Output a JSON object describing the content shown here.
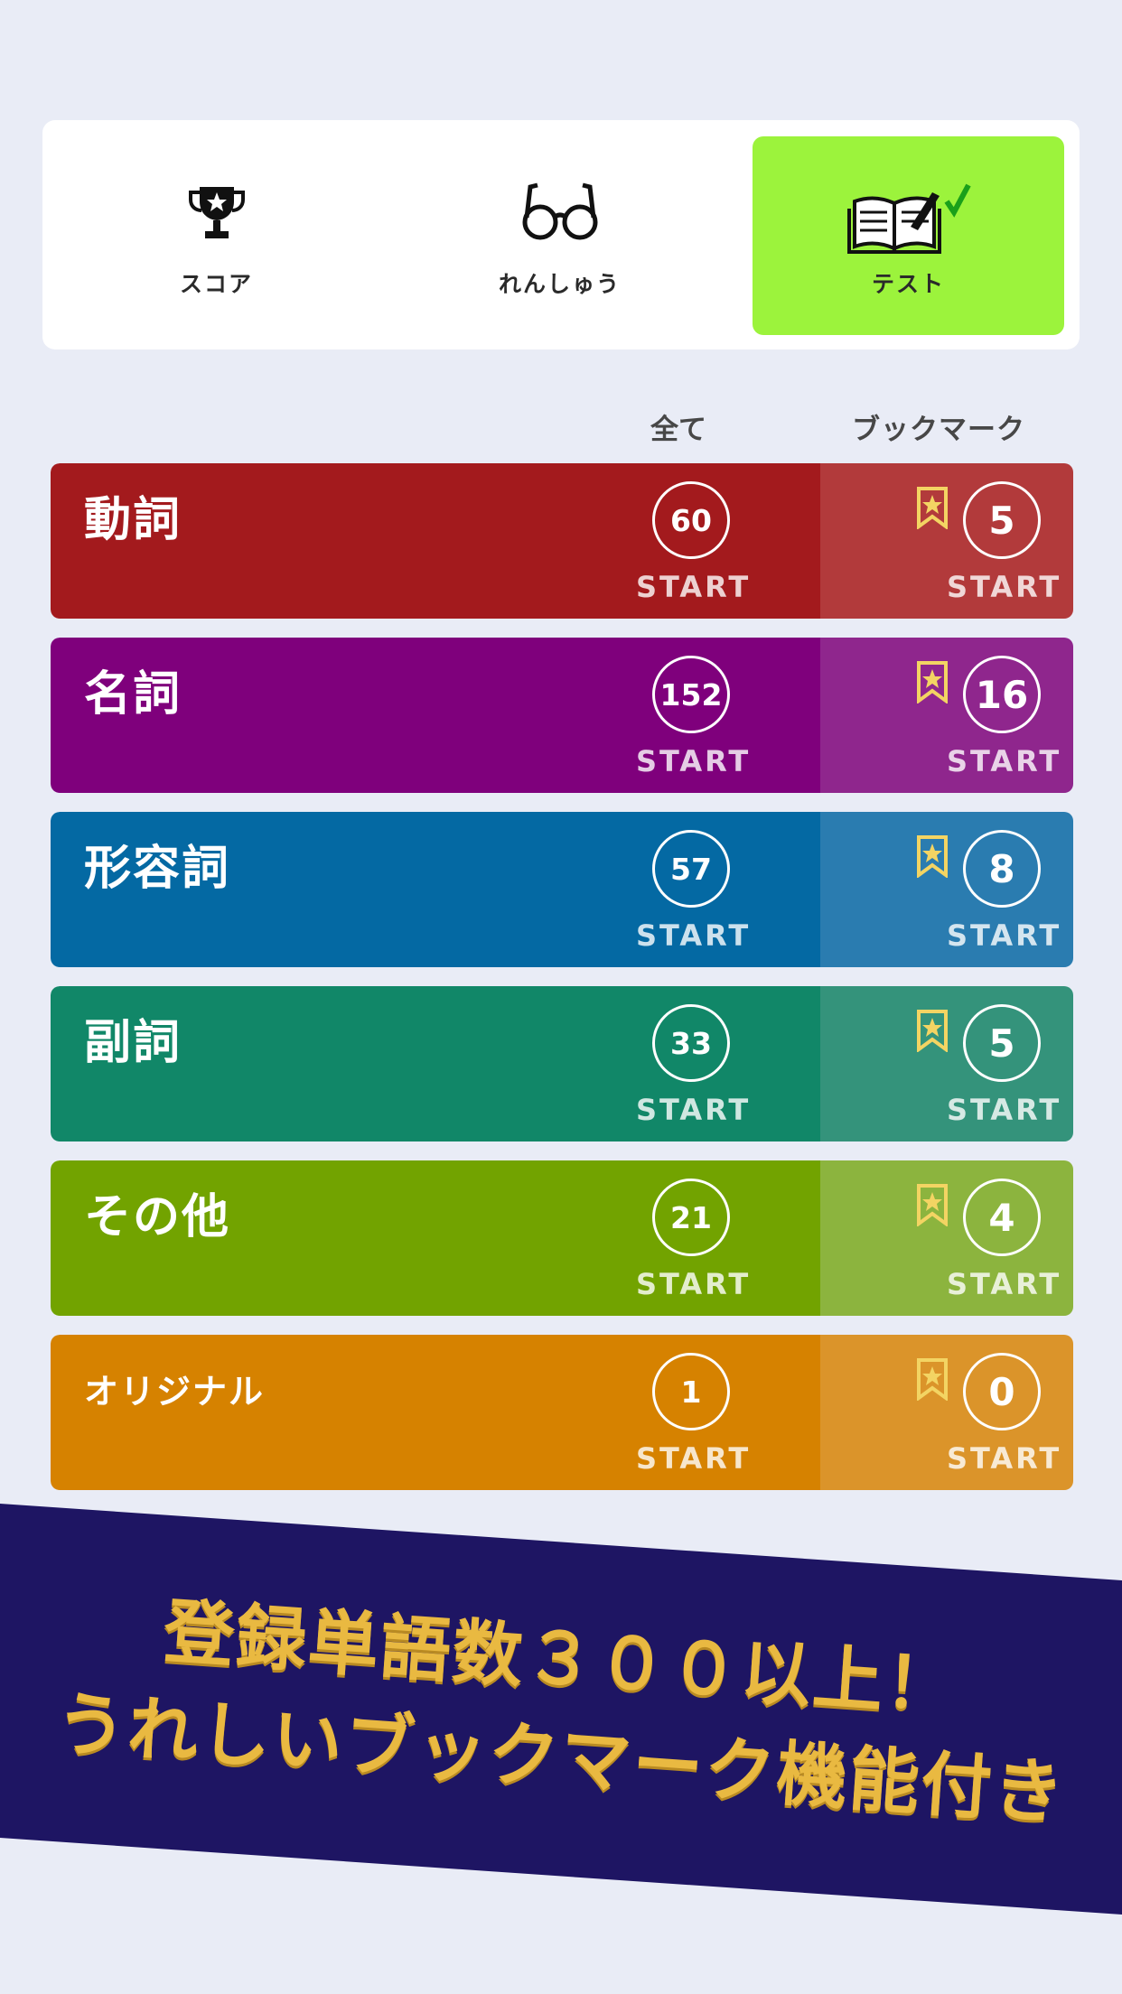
{
  "tabs": [
    {
      "label": "スコア",
      "icon": "trophy-icon"
    },
    {
      "label": "れんしゅう",
      "icon": "glasses-icon"
    },
    {
      "label": "テスト",
      "icon": "open-book-check-icon",
      "active": true
    }
  ],
  "columns": {
    "all": "全て",
    "bookmark": "ブックマーク"
  },
  "categories": [
    {
      "title": "動詞",
      "count": "60",
      "bookmark_count": "5",
      "start": "START",
      "color_main": "#a31a1d",
      "color_side": "#b23a3b"
    },
    {
      "title": "名詞",
      "count": "152",
      "bookmark_count": "16",
      "start": "START",
      "color_main": "#7f007c",
      "color_side": "#8f268d"
    },
    {
      "title": "形容詞",
      "count": "57",
      "bookmark_count": "8",
      "start": "START",
      "color_main": "#0469a3",
      "color_side": "#2a7cb0"
    },
    {
      "title": "副詞",
      "count": "33",
      "bookmark_count": "5",
      "start": "START",
      "color_main": "#118768",
      "color_side": "#34937b"
    },
    {
      "title": "その他",
      "count": "21",
      "bookmark_count": "4",
      "start": "START",
      "color_main": "#72a300",
      "color_side": "#8cb43e"
    },
    {
      "title": "オリジナル",
      "count": "1",
      "bookmark_count": "0",
      "start": "START",
      "color_main": "#d68200",
      "color_side": "#db942a"
    }
  ],
  "banner": {
    "line1": "登録単語数３００以上！",
    "line2": "うれしいブックマーク機能付き"
  }
}
